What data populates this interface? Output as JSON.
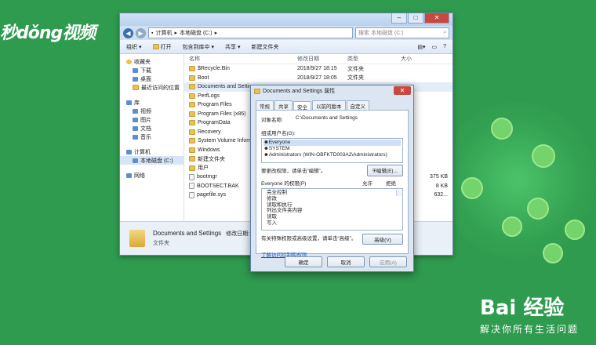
{
  "overlay": {
    "watermark_tl": "秒dǒng视频",
    "brand_br": "Bai 经验",
    "slogan_br": "解决你所有生活问题"
  },
  "explorer": {
    "breadcrumb": [
      "计算机",
      "本地磁盘 (C:)"
    ],
    "search_placeholder": "搜索 本地磁盘 (C:)",
    "toolbar": {
      "organize": "组织",
      "open": "打开",
      "include": "包含到库中",
      "share": "共享",
      "new_folder": "新建文件夹"
    },
    "nav": {
      "favorites": "收藏夹",
      "downloads": "下载",
      "desktop": "桌面",
      "recent": "最近访问的位置",
      "libraries": "库",
      "videos": "视频",
      "pictures": "图片",
      "documents": "文档",
      "music": "音乐",
      "computer": "计算机",
      "local_disk": "本地磁盘 (C:)",
      "network": "网络"
    },
    "columns": {
      "name": "名称",
      "date": "修改日期",
      "type": "类型",
      "size": "大小"
    },
    "files": [
      {
        "name": "$Recycle.Bin",
        "date": "2018/9/27 18:15",
        "type": "文件夹",
        "size": ""
      },
      {
        "name": "Boot",
        "date": "2018/9/27 18:05",
        "type": "文件夹",
        "size": ""
      },
      {
        "name": "Documents and Settings",
        "date": "",
        "type": "",
        "size": ""
      },
      {
        "name": "PerfLogs",
        "date": "",
        "type": "",
        "size": ""
      },
      {
        "name": "Program Files",
        "date": "",
        "type": "",
        "size": ""
      },
      {
        "name": "Program Files (x86)",
        "date": "",
        "type": "",
        "size": ""
      },
      {
        "name": "ProgramData",
        "date": "",
        "type": "",
        "size": ""
      },
      {
        "name": "Recovery",
        "date": "",
        "type": "",
        "size": ""
      },
      {
        "name": "System Volume Information",
        "date": "",
        "type": "",
        "size": ""
      },
      {
        "name": "Windows",
        "date": "",
        "type": "",
        "size": ""
      },
      {
        "name": "新建文件夹",
        "date": "",
        "type": "",
        "size": ""
      },
      {
        "name": "用户",
        "date": "",
        "type": "",
        "size": ""
      },
      {
        "name": "bootmgr",
        "date": "",
        "type": "",
        "size": "375 KB"
      },
      {
        "name": "BOOTSECT.BAK",
        "date": "",
        "type": "",
        "size": "8 KB"
      },
      {
        "name": "pagefile.sys",
        "date": "",
        "type": "",
        "size": "632..."
      }
    ],
    "status": {
      "name": "Documents and Settings",
      "modified_label": "修改日期: 2018",
      "type": "文件夹"
    }
  },
  "dialog": {
    "title": "Documents and Settings 属性",
    "tabs": [
      "常规",
      "共享",
      "安全",
      "以前的版本",
      "自定义"
    ],
    "object_label": "对象名称:",
    "object_value": "C:\\Documents and Settings",
    "group_label": "组或用户名(G):",
    "users": [
      "Everyone",
      "SYSTEM",
      "Administrators (WIN-OBFKTD003A2\\Administrators)"
    ],
    "edit_hint": "要更改权限，请单击“编辑”。",
    "edit_button": "编辑(E)...",
    "perm_for": "Everyone 的权限(P)",
    "allow": "允许",
    "deny": "拒绝",
    "permissions": [
      "完全控制",
      "修改",
      "读取和执行",
      "列出文件夹内容",
      "读取",
      "写入"
    ],
    "advanced_hint": "有关特殊权限或高级设置，请单击“高级”。",
    "advanced_button": "高级(V)",
    "link": "了解访问控制和权限",
    "ok": "确定",
    "cancel": "取消",
    "apply": "应用(A)"
  }
}
